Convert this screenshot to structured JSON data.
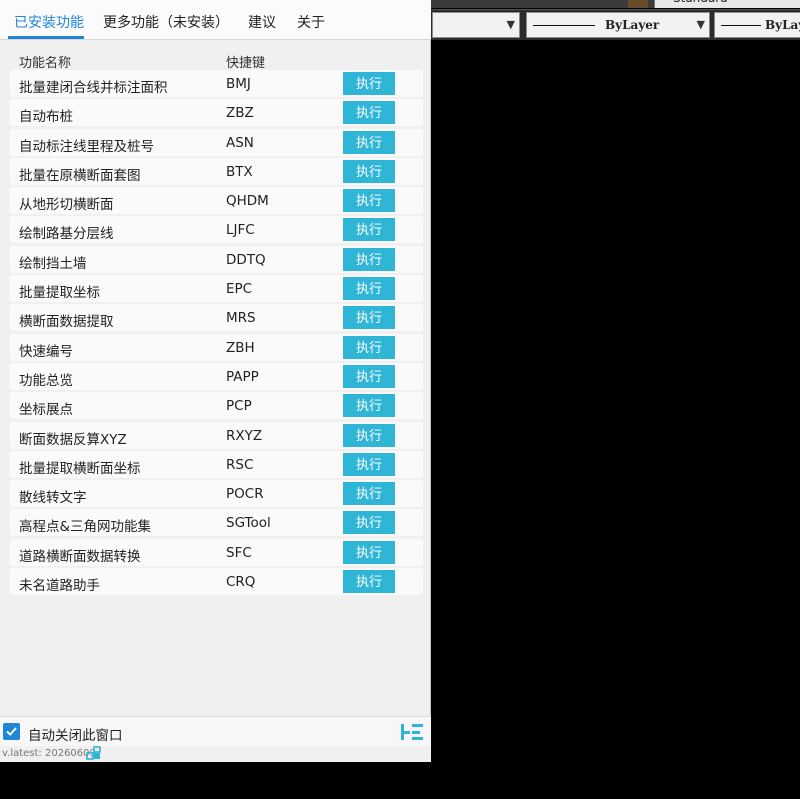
{
  "cad": {
    "text_style": "Standard",
    "linetype": "ByLayer",
    "lineweight": "ByLay"
  },
  "tabs": [
    {
      "label": "已安装功能",
      "active": true
    },
    {
      "label": "更多功能（未安装）",
      "active": false
    },
    {
      "label": "建议",
      "active": false
    },
    {
      "label": "关于",
      "active": false
    }
  ],
  "columns": {
    "name": "功能名称",
    "key": "快捷键"
  },
  "run_label": "执行",
  "functions": [
    {
      "name": "批量建闭合线并标注面积",
      "key": "BMJ"
    },
    {
      "name": "自动布桩",
      "key": "ZBZ"
    },
    {
      "name": "自动标注线里程及桩号",
      "key": "ASN"
    },
    {
      "name": "批量在原横断面套图",
      "key": "BTX"
    },
    {
      "name": "从地形切横断面",
      "key": "QHDM"
    },
    {
      "name": "绘制路基分层线",
      "key": "LJFC"
    },
    {
      "name": "绘制挡土墙",
      "key": "DDTQ"
    },
    {
      "name": "批量提取坐标",
      "key": "EPC"
    },
    {
      "name": "横断面数据提取",
      "key": "MRS"
    },
    {
      "name": "快速编号",
      "key": "ZBH"
    },
    {
      "name": "功能总览",
      "key": "PAPP"
    },
    {
      "name": "坐标展点",
      "key": "PCP"
    },
    {
      "name": "断面数据反算XYZ",
      "key": "RXYZ"
    },
    {
      "name": "批量提取横断面坐标",
      "key": "RSC"
    },
    {
      "name": "散线转文字",
      "key": "POCR"
    },
    {
      "name": "高程点&三角网功能集",
      "key": "SGTool"
    },
    {
      "name": "道路横断面数据转换",
      "key": "SFC"
    },
    {
      "name": "未名道路助手",
      "key": "CRQ"
    }
  ],
  "footer": {
    "auto_close_label": "自动关闭此窗口",
    "auto_close_checked": true,
    "version": "v.latest: 20260609"
  },
  "colors": {
    "accent": "#1f86d8",
    "run_button": "#2fb5d6"
  }
}
